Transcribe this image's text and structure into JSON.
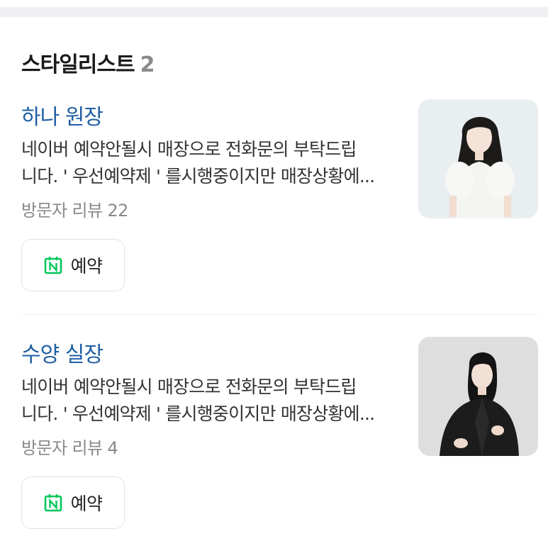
{
  "section": {
    "title": "스타일리스트",
    "count": "2"
  },
  "stylists": [
    {
      "name": "하나 원장",
      "description_line1": "네이버 예약안될시 매장으로 전화문의 부탁드립",
      "description_line2": "니다. ' 우선예약제 ' 를시행중이지만 매장상황에...",
      "reviews": "방문자 리뷰 22",
      "book_label": "예약",
      "photo_background": "#e8eef2",
      "outfit_color": "#f4f4f2"
    },
    {
      "name": "수양 실장",
      "description_line1": "네이버 예약안될시 매장으로 전화문의 부탁드립",
      "description_line2": "니다. ' 우선예약제 ' 를시행중이지만 매장상황에...",
      "reviews": "방문자 리뷰 4",
      "book_label": "예약",
      "photo_background": "#dcdcdc",
      "outfit_color": "#1c1c1c"
    }
  ],
  "icons": {
    "calendar": "calendar-naver-icon"
  },
  "colors": {
    "name_link": "#1f5fa3",
    "naver_green": "#03c75a",
    "muted_text": "#8a8a8a",
    "border": "#e1e3e6"
  }
}
